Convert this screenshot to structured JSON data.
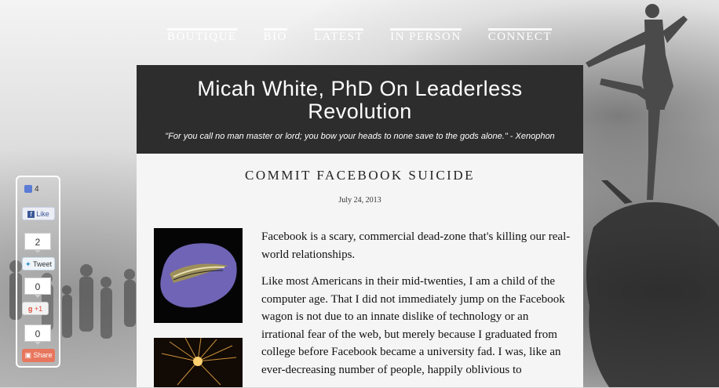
{
  "nav": {
    "items": [
      "BOUTIQUE",
      "BIO",
      "LATEST",
      "IN PERSON",
      "CONNECT"
    ]
  },
  "header": {
    "title": "Micah White, PhD On Leaderless Revolution",
    "quote": "\"For you call no man master or lord; you bow your heads to none save to the gods alone.\" - Xenophon"
  },
  "post": {
    "title": "COMMIT FACEBOOK SUICIDE",
    "date": "July 24, 2013",
    "paragraphs": [
      "Facebook is a scary, commercial dead-zone that's killing our real-world relationships.",
      "Like most Americans in their mid-twenties, I am a child of the computer age. That I did not immediately jump on the Facebook wagon is not due to an innate dislike of technology or an irrational fear of the web, but merely because I graduated from college before Facebook became a university fad. I was, like an ever-decreasing number of people, happily oblivious to"
    ]
  },
  "share": {
    "facebook": {
      "count": "4",
      "label": "Like"
    },
    "twitter": {
      "count": "2",
      "label": "Tweet"
    },
    "google": {
      "count": "0",
      "label": "+1"
    },
    "share": {
      "count": "0",
      "label": "Share"
    }
  },
  "colors": {
    "header_bg": "#2d2d2d",
    "content_bg": "#f5f5f5",
    "twitter": "#2d8ec9",
    "google": "#dd4b39",
    "share": "#e8765d"
  }
}
